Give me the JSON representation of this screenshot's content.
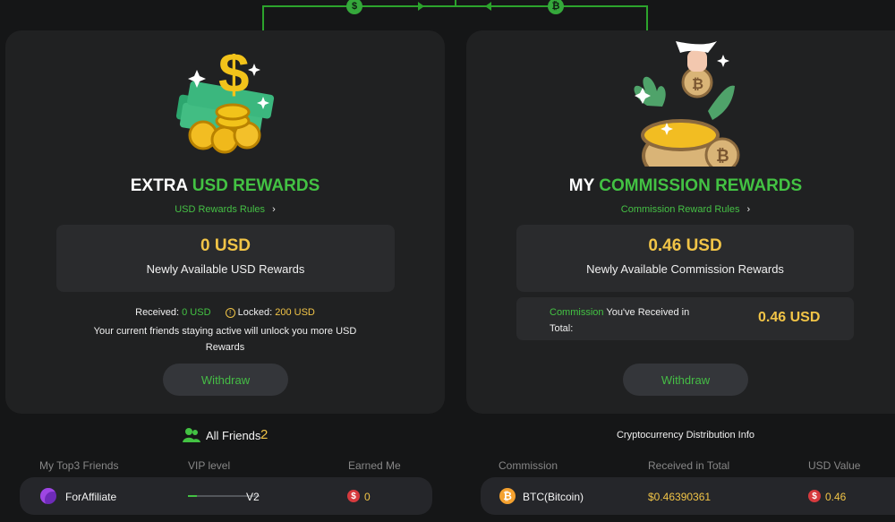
{
  "connector": {
    "left_coin_icon": "dollar-icon",
    "right_coin_icon": "bitcoin-icon",
    "line_color": "#2ca32c"
  },
  "usd_panel": {
    "title_prefix": "EXTRA",
    "title_highlight": "USD REWARDS",
    "rules_link": "USD Rewards Rules",
    "reward_value": "0 USD",
    "reward_label": "Newly Available USD Rewards",
    "received_label": "Received:",
    "received_value": "0 USD",
    "locked_label": "Locked:",
    "locked_value": "200 USD",
    "info_line_1": "Your current friends staying active will unlock you more USD",
    "info_line_2": "Rewards",
    "withdraw_label": "Withdraw"
  },
  "commission_panel": {
    "title_prefix": "MY",
    "title_highlight": "COMMISSION REWARDS",
    "rules_link": "Commission Reward Rules",
    "reward_value": "0.46  USD",
    "reward_label": "Newly Available Commission Rewards",
    "received_total_label_highlight": "Commission",
    "received_total_label_line_1_rest": " You've Received in",
    "received_total_label_line_2": "Total:",
    "received_total_value": "0.46 USD",
    "withdraw_label": "Withdraw"
  },
  "friends_section": {
    "all_friends_label": "All Friends",
    "all_friends_count": "2",
    "columns": [
      "My Top3 Friends",
      "VIP level",
      "Earned Me"
    ],
    "rows": [
      {
        "name": "ForAffiliate",
        "vip_level": "V2",
        "vip_progress": 0.12,
        "earned": "0"
      }
    ]
  },
  "crypto_section": {
    "title": "Cryptocurrency Distribution Info",
    "columns": [
      "Commission",
      "Received in Total",
      "USD Value"
    ],
    "rows": [
      {
        "currency": "BTC(Bitcoin)",
        "received_total": "$0.46390361",
        "usd_value": "0.46"
      }
    ]
  },
  "colors": {
    "background": "#151617",
    "panel": "#202122",
    "green": "#43c243",
    "gold": "#f1c447",
    "button": "#34363a",
    "red_coin": "#d63a3e",
    "bitcoin": "#f4a12f"
  }
}
